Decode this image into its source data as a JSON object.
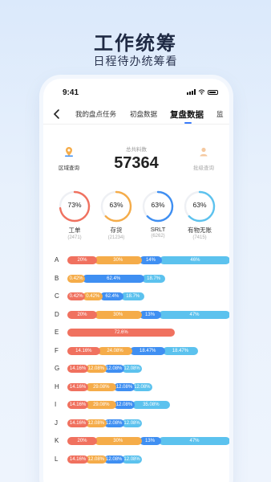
{
  "promo": {
    "title": "工作统筹",
    "subtitle": "日程待办统筹看"
  },
  "status": {
    "time": "9:41"
  },
  "tabs": [
    {
      "label": "我的盘点任务",
      "active": false
    },
    {
      "label": "初盘数据",
      "active": false
    },
    {
      "label": "复盘数据",
      "active": true
    },
    {
      "label": "监",
      "active": false
    }
  ],
  "summary": {
    "label": "总共料数",
    "value": "57364",
    "left_button": "区域查询",
    "right_button": "批级查询"
  },
  "rings": [
    {
      "percent_text": "73%",
      "value": 0.73,
      "name": "工单",
      "count": "(2471)",
      "color": "#f0715f"
    },
    {
      "percent_text": "63%",
      "value": 0.63,
      "name": "存货",
      "count": "(21234)",
      "color": "#f5ac49"
    },
    {
      "percent_text": "63%",
      "value": 0.63,
      "name": "SRLT",
      "count": "(6262)",
      "color": "#3f8ff2"
    },
    {
      "percent_text": "63%",
      "value": 0.63,
      "name": "有物无账",
      "count": "(7415)",
      "color": "#5cc2ee"
    }
  ],
  "colors": {
    "red": "#f0715f",
    "orange": "#f5ac49",
    "blue": "#3f8ff2",
    "cyan": "#5cc2ee",
    "accent": "#3a7bfa"
  },
  "chart_data": {
    "type": "bar",
    "stacked": true,
    "categories": [
      "A",
      "B",
      "C",
      "D",
      "E",
      "F",
      "G",
      "H",
      "I",
      "J",
      "K",
      "L"
    ],
    "rows": [
      {
        "letter": "A",
        "segments": [
          {
            "label": "20%",
            "value": 20,
            "color": "red"
          },
          {
            "label": "30%",
            "value": 30,
            "color": "orange"
          },
          {
            "label": "14%",
            "value": 14,
            "color": "blue"
          },
          {
            "label": "46%",
            "value": 46,
            "color": "cyan"
          }
        ]
      },
      {
        "letter": "B",
        "segments": [
          {
            "label": "0.42%",
            "value": 12,
            "color": "orange"
          },
          {
            "label": "62.4%",
            "value": 40,
            "color": "blue"
          },
          {
            "label": "18.7%",
            "value": 14,
            "color": "cyan"
          }
        ]
      },
      {
        "letter": "C",
        "segments": [
          {
            "label": "0.42%",
            "value": 12,
            "color": "red"
          },
          {
            "label": "0.42%",
            "value": 12,
            "color": "orange"
          },
          {
            "label": "62.4%",
            "value": 14,
            "color": "blue"
          },
          {
            "label": "18.7%",
            "value": 14,
            "color": "cyan"
          }
        ]
      },
      {
        "letter": "D",
        "segments": [
          {
            "label": "20%",
            "value": 20,
            "color": "red"
          },
          {
            "label": "30%",
            "value": 30,
            "color": "orange"
          },
          {
            "label": "13%",
            "value": 13,
            "color": "blue"
          },
          {
            "label": "47%",
            "value": 47,
            "color": "cyan"
          }
        ]
      },
      {
        "letter": "E",
        "segments": [
          {
            "label": "72.6%",
            "value": 72.6,
            "color": "red"
          }
        ]
      },
      {
        "letter": "F",
        "segments": [
          {
            "label": "14.16%",
            "value": 22,
            "color": "red"
          },
          {
            "label": "24.08%",
            "value": 22,
            "color": "orange"
          },
          {
            "label": "18.47%",
            "value": 22,
            "color": "blue"
          },
          {
            "label": "18.47%",
            "value": 22,
            "color": "cyan"
          }
        ]
      },
      {
        "letter": "G",
        "segments": [
          {
            "label": "14.16%",
            "value": 14.16,
            "color": "red"
          },
          {
            "label": "12.08%",
            "value": 12.08,
            "color": "orange"
          },
          {
            "label": "12.08%",
            "value": 12.08,
            "color": "blue"
          },
          {
            "label": "12.08%",
            "value": 12.08,
            "color": "cyan"
          }
        ]
      },
      {
        "letter": "H",
        "segments": [
          {
            "label": "14.16%",
            "value": 14.16,
            "color": "red"
          },
          {
            "label": "29.08%",
            "value": 19,
            "color": "orange"
          },
          {
            "label": "12.08%",
            "value": 12.08,
            "color": "blue"
          },
          {
            "label": "12.08%",
            "value": 12.08,
            "color": "cyan"
          }
        ]
      },
      {
        "letter": "I",
        "segments": [
          {
            "label": "14.16%",
            "value": 14.16,
            "color": "red"
          },
          {
            "label": "29.08%",
            "value": 19,
            "color": "orange"
          },
          {
            "label": "12.08%",
            "value": 12.08,
            "color": "blue"
          },
          {
            "label": "35.08%",
            "value": 24,
            "color": "cyan"
          }
        ]
      },
      {
        "letter": "J",
        "segments": [
          {
            "label": "14.16%",
            "value": 14.16,
            "color": "red"
          },
          {
            "label": "12.08%",
            "value": 12.08,
            "color": "orange"
          },
          {
            "label": "12.08%",
            "value": 12.08,
            "color": "blue"
          },
          {
            "label": "12.08%",
            "value": 12.08,
            "color": "cyan"
          }
        ]
      },
      {
        "letter": "K",
        "segments": [
          {
            "label": "20%",
            "value": 20,
            "color": "red"
          },
          {
            "label": "30%",
            "value": 30,
            "color": "orange"
          },
          {
            "label": "13%",
            "value": 13,
            "color": "blue"
          },
          {
            "label": "47%",
            "value": 47,
            "color": "cyan"
          }
        ]
      },
      {
        "letter": "L",
        "segments": [
          {
            "label": "14.16%",
            "value": 14.16,
            "color": "red"
          },
          {
            "label": "12.08%",
            "value": 12.08,
            "color": "orange"
          },
          {
            "label": "12.08%",
            "value": 12.08,
            "color": "blue"
          },
          {
            "label": "12.08%",
            "value": 12.08,
            "color": "cyan"
          }
        ]
      }
    ]
  }
}
